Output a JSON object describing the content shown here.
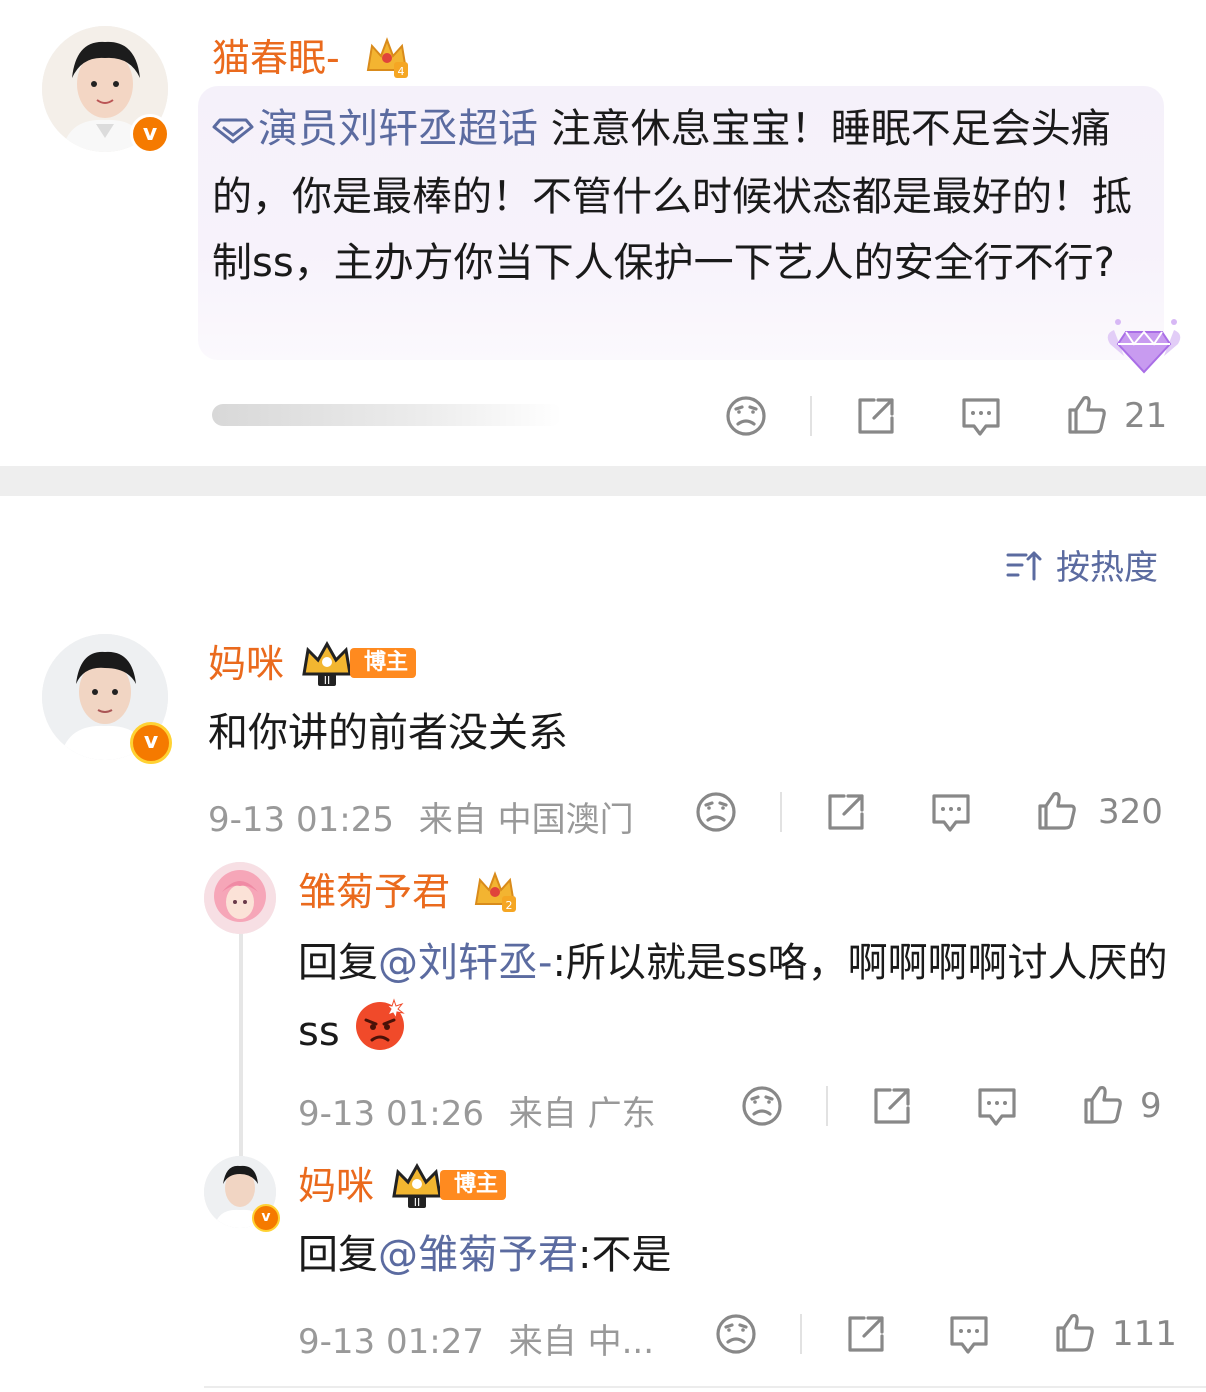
{
  "top_comment": {
    "username": "猫春眠-",
    "topic_link": "演员刘轩丞超话",
    "text": "注意休息宝宝！睡眠不足会头痛的，你是最棒的！不管什么时候状态都是最好的！抵制ss，主办方你当下人保护一下艺人的安全行不行?",
    "like_count": "21",
    "crown_level": "4"
  },
  "sort": {
    "label": "按热度"
  },
  "comment": {
    "username": "妈咪",
    "badge": "博主",
    "crown_level": "II",
    "text": "和你讲的前者没关系",
    "time": "9-13 01:25",
    "source": "来自 中国澳门",
    "like_count": "320"
  },
  "replies": [
    {
      "username": "雏菊予君",
      "crown_level": "2",
      "reply_prefix": "回复",
      "mention": "@刘轩丞-",
      "text": ":所以就是ss咯，啊啊啊啊讨人厌的ss",
      "time": "9-13 01:26",
      "source": "来自 广东",
      "like_count": "9"
    },
    {
      "username": "妈咪",
      "badge": "博主",
      "crown_level": "II",
      "reply_prefix": "回复",
      "mention": "@雏菊予君",
      "text": ":不是",
      "time": "9-13 01:27",
      "source": "来自 中...",
      "like_count": "111"
    }
  ],
  "colors": {
    "username": "#ea6a1d",
    "link": "#5b6ba0",
    "meta": "#999999",
    "highlight_bg": "#f3eef8",
    "section_divider": "#eeeeee"
  },
  "icons": [
    "diamond-icon",
    "unhappy-face-icon",
    "share-icon",
    "comment-icon",
    "thumbs-up-icon",
    "sort-icon",
    "crown-icon",
    "verified-icon",
    "angry-emoji-icon"
  ]
}
